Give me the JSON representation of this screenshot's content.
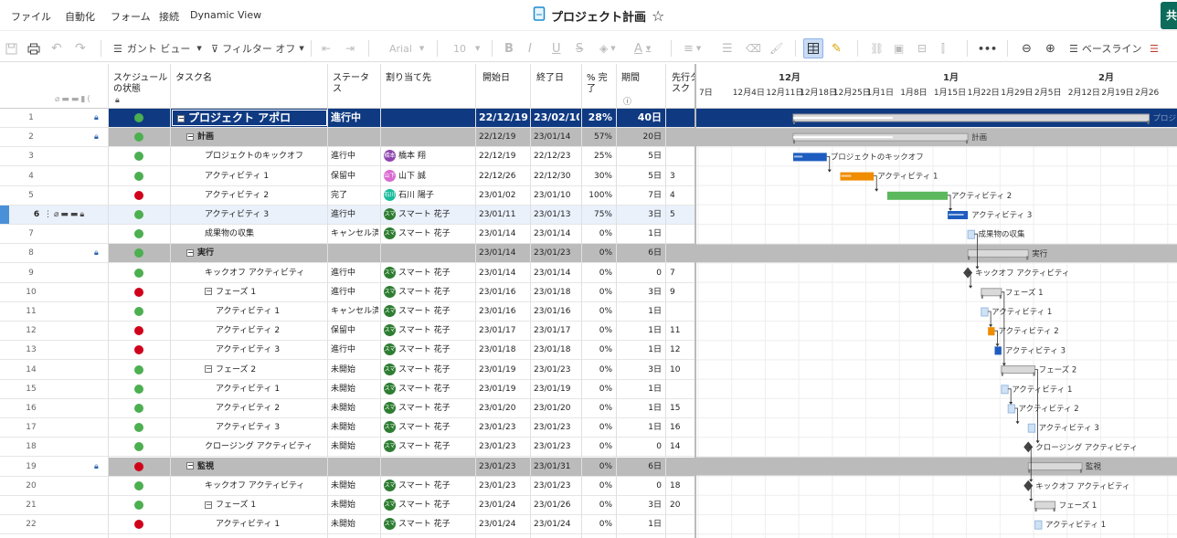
{
  "menubar": {
    "items": [
      "ファイル",
      "自動化",
      "フォーム",
      "接続",
      "Dynamic View"
    ],
    "title": "プロジェクト計画",
    "share": "共"
  },
  "toolbar": {
    "gantt_view": "ガント ビュー",
    "filter": "フィルター オフ",
    "font": "Arial",
    "size": "10",
    "baseline": "ベースライン",
    "more": "•••"
  },
  "columns": {
    "schedule": "スケジュール の状態",
    "task": "タスク名",
    "status": "ステータ ス",
    "assigned": "割り当て先",
    "start": "開始日",
    "end": "終了日",
    "percent": "% 完 了",
    "duration": "期間",
    "pred": "先行タ スク"
  },
  "colors": {
    "header_blue": "#0f3a82",
    "section_gray": "#bbbbbb",
    "green": "#4caf50",
    "red": "#d0021b",
    "bar_blue": "#1e5cbf",
    "bar_orange": "#f08c00",
    "bar_green": "#5cb85c"
  },
  "timeline": {
    "months": [
      "12月",
      "1月",
      "2月"
    ],
    "weeks": [
      "7日",
      "12月4日",
      "12月11日",
      "12月18日",
      "12月25日",
      "1月1日",
      "1月8日",
      "1月15日",
      "1月22日",
      "1月29日",
      "2月5日",
      "2月12日",
      "2月19日",
      "2月26"
    ]
  },
  "rows": [
    {
      "n": "1",
      "sch": "green",
      "task": "プロジェクト アポロ",
      "level": 0,
      "type": "top",
      "status": "進行中",
      "who": "",
      "av": "",
      "avc": "",
      "start": "22/12/19",
      "end": "23/02/10",
      "pct": "28%",
      "dur": "40日",
      "pred": "",
      "lock": true,
      "bar": {
        "kind": "summary",
        "s": 0,
        "e": 53,
        "p": 0.28
      },
      "label": "プロジェクト アポロ"
    },
    {
      "n": "2",
      "sch": "green",
      "task": "計画",
      "level": 1,
      "type": "section",
      "status": "",
      "who": "",
      "av": "",
      "avc": "",
      "start": "22/12/19",
      "end": "23/01/14",
      "pct": "57%",
      "dur": "20日",
      "pred": "",
      "lock": true,
      "bar": {
        "kind": "summary",
        "s": 0,
        "e": 26,
        "p": 0.57
      },
      "label": "計画"
    },
    {
      "n": "3",
      "sch": "green",
      "task": "プロジェクトのキックオフ",
      "level": 2,
      "type": "task",
      "status": "進行中",
      "who": "橋本 翔",
      "av": "橋本",
      "avc": "#8e44ad",
      "start": "22/12/19",
      "end": "22/12/23",
      "pct": "25%",
      "dur": "5日",
      "pred": "",
      "bar": {
        "kind": "task",
        "s": 0,
        "e": 5,
        "p": 0.25,
        "c": "bar_blue"
      },
      "label": "プロジェクトのキックオフ"
    },
    {
      "n": "4",
      "sch": "green",
      "task": "アクティビティ 1",
      "level": 2,
      "type": "task",
      "status": "保留中",
      "who": "山下 誠",
      "av": "山下",
      "avc": "#d96ad0",
      "start": "22/12/26",
      "end": "22/12/30",
      "pct": "30%",
      "dur": "5日",
      "pred": "3",
      "bar": {
        "kind": "task",
        "s": 7,
        "e": 12,
        "p": 0.3,
        "c": "bar_orange"
      },
      "label": "アクティビティ 1"
    },
    {
      "n": "5",
      "sch": "red",
      "task": "アクティビティ 2",
      "level": 2,
      "type": "task",
      "status": "完了",
      "who": "石川 陽子",
      "av": "石川",
      "avc": "#1abc9c",
      "start": "23/01/02",
      "end": "23/01/10",
      "pct": "100%",
      "dur": "7日",
      "pred": "4",
      "bar": {
        "kind": "task",
        "s": 14,
        "e": 23,
        "p": 1,
        "c": "bar_green"
      },
      "label": "アクティビティ 2"
    },
    {
      "n": "6",
      "sch": "green",
      "task": "アクティビティ 3",
      "level": 2,
      "type": "task",
      "status": "進行中",
      "who": "スマート 花子",
      "av": "スマ",
      "avc": "#2e7d32",
      "start": "23/01/11",
      "end": "23/01/13",
      "pct": "75%",
      "dur": "3日",
      "pred": "5",
      "selected": true,
      "bar": {
        "kind": "task",
        "s": 23,
        "e": 26,
        "p": 0.75,
        "c": "bar_blue"
      },
      "label": "アクティビティ 3"
    },
    {
      "n": "7",
      "sch": "green",
      "task": "成果物の収集",
      "level": 2,
      "type": "task",
      "status": "キャンセル済",
      "who": "スマート 花子",
      "av": "スマ",
      "avc": "#2e7d32",
      "start": "23/01/14",
      "end": "23/01/14",
      "pct": "0%",
      "dur": "1日",
      "pred": "",
      "bar": {
        "kind": "task",
        "s": 26,
        "e": 27,
        "p": 0,
        "c": "bar_blue"
      },
      "label": "成果物の収集"
    },
    {
      "n": "8",
      "sch": "green",
      "task": "実行",
      "level": 1,
      "type": "section",
      "status": "",
      "who": "",
      "av": "",
      "avc": "",
      "start": "23/01/14",
      "end": "23/01/23",
      "pct": "0%",
      "dur": "6日",
      "pred": "",
      "lock": true,
      "bar": {
        "kind": "summary",
        "s": 26,
        "e": 35,
        "p": 0
      },
      "label": "実行"
    },
    {
      "n": "9",
      "sch": "green",
      "task": "キックオフ アクティビティ",
      "level": 2,
      "type": "task",
      "status": "進行中",
      "who": "スマート 花子",
      "av": "スマ",
      "avc": "#2e7d32",
      "start": "23/01/14",
      "end": "23/01/14",
      "pct": "0%",
      "dur": "0",
      "pred": "7",
      "bar": {
        "kind": "milestone",
        "s": 26
      },
      "label": "キックオフ アクティビティ"
    },
    {
      "n": "10",
      "sch": "red",
      "task": "フェーズ 1",
      "level": 2,
      "type": "group",
      "status": "進行中",
      "who": "スマート 花子",
      "av": "スマ",
      "avc": "#2e7d32",
      "start": "23/01/16",
      "end": "23/01/18",
      "pct": "0%",
      "dur": "3日",
      "pred": "9",
      "bar": {
        "kind": "summary",
        "s": 28,
        "e": 31,
        "p": 0
      },
      "label": "フェーズ 1"
    },
    {
      "n": "11",
      "sch": "green",
      "task": "アクティビティ 1",
      "level": 3,
      "type": "task",
      "status": "キャンセル済",
      "who": "スマート 花子",
      "av": "スマ",
      "avc": "#2e7d32",
      "start": "23/01/16",
      "end": "23/01/16",
      "pct": "0%",
      "dur": "1日",
      "pred": "",
      "bar": {
        "kind": "task",
        "s": 28,
        "e": 29,
        "p": 0,
        "c": "bar_blue"
      },
      "label": "アクティビティ 1"
    },
    {
      "n": "12",
      "sch": "red",
      "task": "アクティビティ 2",
      "level": 3,
      "type": "task",
      "status": "保留中",
      "who": "スマート 花子",
      "av": "スマ",
      "avc": "#2e7d32",
      "start": "23/01/17",
      "end": "23/01/17",
      "pct": "0%",
      "dur": "1日",
      "pred": "11",
      "bar": {
        "kind": "task",
        "s": 29,
        "e": 30,
        "p": 0,
        "c": "bar_orange"
      },
      "label": "アクティビティ 2"
    },
    {
      "n": "13",
      "sch": "red",
      "task": "アクティビティ 3",
      "level": 3,
      "type": "task",
      "status": "進行中",
      "who": "スマート 花子",
      "av": "スマ",
      "avc": "#2e7d32",
      "start": "23/01/18",
      "end": "23/01/18",
      "pct": "0%",
      "dur": "1日",
      "pred": "12",
      "bar": {
        "kind": "task",
        "s": 30,
        "e": 31,
        "p": 0,
        "c": "bar_blue"
      },
      "label": "アクティビティ 3"
    },
    {
      "n": "14",
      "sch": "green",
      "task": "フェーズ 2",
      "level": 2,
      "type": "group",
      "status": "未開始",
      "who": "スマート 花子",
      "av": "スマ",
      "avc": "#2e7d32",
      "start": "23/01/19",
      "end": "23/01/23",
      "pct": "0%",
      "dur": "3日",
      "pred": "10",
      "bar": {
        "kind": "summary",
        "s": 31,
        "e": 36,
        "p": 0
      },
      "label": "フェーズ 2"
    },
    {
      "n": "15",
      "sch": "green",
      "task": "アクティビティ 1",
      "level": 3,
      "type": "task",
      "status": "未開始",
      "who": "スマート 花子",
      "av": "スマ",
      "avc": "#2e7d32",
      "start": "23/01/19",
      "end": "23/01/19",
      "pct": "0%",
      "dur": "1日",
      "pred": "",
      "bar": {
        "kind": "task",
        "s": 31,
        "e": 32,
        "p": 0,
        "c": "bar_blue"
      },
      "label": "アクティビティ 1"
    },
    {
      "n": "16",
      "sch": "green",
      "task": "アクティビティ 2",
      "level": 3,
      "type": "task",
      "status": "未開始",
      "who": "スマート 花子",
      "av": "スマ",
      "avc": "#2e7d32",
      "start": "23/01/20",
      "end": "23/01/20",
      "pct": "0%",
      "dur": "1日",
      "pred": "15",
      "bar": {
        "kind": "task",
        "s": 32,
        "e": 33,
        "p": 0,
        "c": "bar_blue"
      },
      "label": "アクティビティ 2"
    },
    {
      "n": "17",
      "sch": "green",
      "task": "アクティビティ 3",
      "level": 3,
      "type": "task",
      "status": "未開始",
      "who": "スマート 花子",
      "av": "スマ",
      "avc": "#2e7d32",
      "start": "23/01/23",
      "end": "23/01/23",
      "pct": "0%",
      "dur": "1日",
      "pred": "16",
      "bar": {
        "kind": "task",
        "s": 35,
        "e": 36,
        "p": 0,
        "c": "bar_blue"
      },
      "label": "アクティビティ 3"
    },
    {
      "n": "18",
      "sch": "green",
      "task": "クロージング アクティビティ",
      "level": 2,
      "type": "task",
      "status": "未開始",
      "who": "スマート 花子",
      "av": "スマ",
      "avc": "#2e7d32",
      "start": "23/01/23",
      "end": "23/01/23",
      "pct": "0%",
      "dur": "0",
      "pred": "14",
      "bar": {
        "kind": "milestone",
        "s": 35
      },
      "label": "クロージング アクティビティ"
    },
    {
      "n": "19",
      "sch": "red",
      "task": "監視",
      "level": 1,
      "type": "section",
      "status": "",
      "who": "",
      "av": "",
      "avc": "",
      "start": "23/01/23",
      "end": "23/01/31",
      "pct": "0%",
      "dur": "6日",
      "pred": "",
      "lock": true,
      "bar": {
        "kind": "summary",
        "s": 35,
        "e": 43,
        "p": 0
      },
      "label": "監視"
    },
    {
      "n": "20",
      "sch": "green",
      "task": "キックオフ アクティビティ",
      "level": 2,
      "type": "task",
      "status": "未開始",
      "who": "スマート 花子",
      "av": "スマ",
      "avc": "#2e7d32",
      "start": "23/01/23",
      "end": "23/01/23",
      "pct": "0%",
      "dur": "0",
      "pred": "18",
      "bar": {
        "kind": "milestone",
        "s": 35
      },
      "label": "キックオフ アクティビティ"
    },
    {
      "n": "21",
      "sch": "green",
      "task": "フェーズ 1",
      "level": 2,
      "type": "group",
      "status": "未開始",
      "who": "スマート 花子",
      "av": "スマ",
      "avc": "#2e7d32",
      "start": "23/01/24",
      "end": "23/01/26",
      "pct": "0%",
      "dur": "3日",
      "pred": "20",
      "bar": {
        "kind": "summary",
        "s": 36,
        "e": 39,
        "p": 0
      },
      "label": "フェーズ 1"
    },
    {
      "n": "22",
      "sch": "red",
      "task": "アクティビティ 1",
      "level": 3,
      "type": "task",
      "status": "未開始",
      "who": "スマート 花子",
      "av": "スマ",
      "avc": "#2e7d32",
      "start": "23/01/24",
      "end": "23/01/24",
      "pct": "0%",
      "dur": "1日",
      "pred": "",
      "bar": {
        "kind": "task",
        "s": 36,
        "e": 37,
        "p": 0,
        "c": "bar_blue"
      },
      "label": "アクティビティ 1"
    }
  ]
}
